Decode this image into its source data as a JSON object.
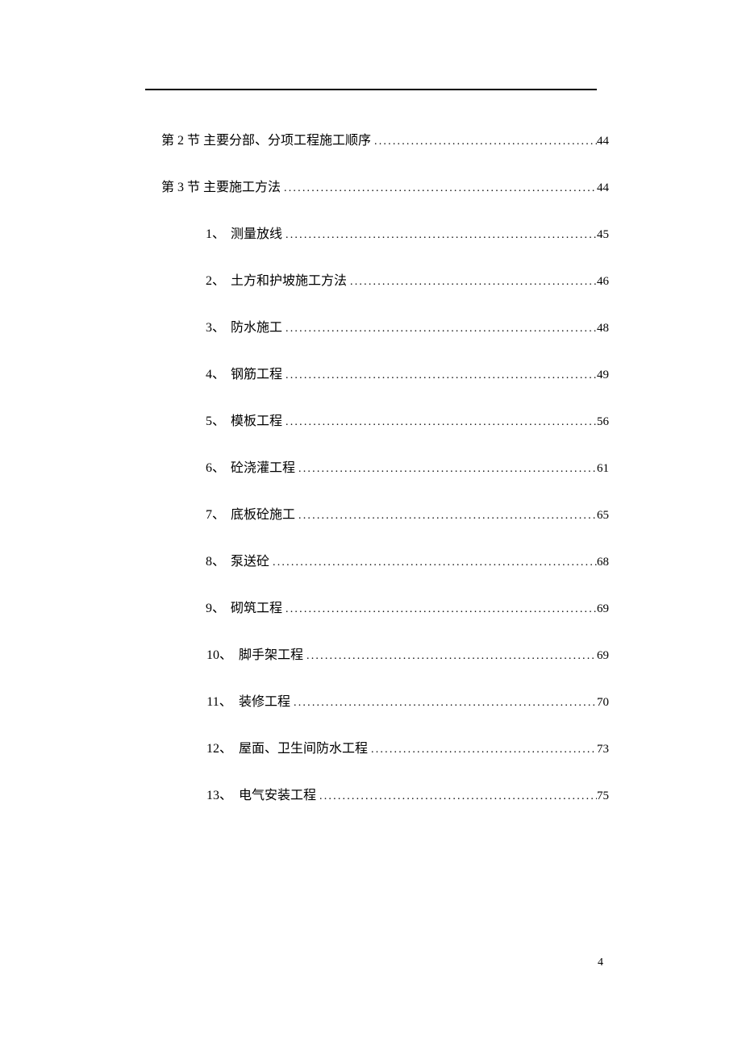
{
  "toc": [
    {
      "level": 0,
      "marker": "",
      "title": "第 2 节 主要分部、分项工程施工顺序",
      "page": "44"
    },
    {
      "level": 0,
      "marker": "",
      "title": "第 3 节 主要施工方法",
      "page": "44"
    },
    {
      "level": 1,
      "marker": "1、",
      "title": "测量放线",
      "page": "45"
    },
    {
      "level": 1,
      "marker": "2、",
      "title": "土方和护坡施工方法",
      "page": "46"
    },
    {
      "level": 1,
      "marker": "3、",
      "title": "防水施工",
      "page": "48"
    },
    {
      "level": 1,
      "marker": "4、",
      "title": "钢筋工程",
      "page": "49"
    },
    {
      "level": 1,
      "marker": "5、",
      "title": "模板工程",
      "page": "56"
    },
    {
      "level": 1,
      "marker": "6、",
      "title": "砼浇灌工程",
      "page": "61"
    },
    {
      "level": 1,
      "marker": "7、",
      "title": "底板砼施工",
      "page": "65"
    },
    {
      "level": 1,
      "marker": "8、",
      "title": "泵送砼",
      "page": "68"
    },
    {
      "level": 1,
      "marker": "9、",
      "title": "砌筑工程",
      "page": "69"
    },
    {
      "level": 1,
      "marker": "10、",
      "title": "脚手架工程",
      "page": "69"
    },
    {
      "level": 1,
      "marker": "11、",
      "title": "装修工程",
      "page": "70"
    },
    {
      "level": 1,
      "marker": "12、",
      "title": "屋面、卫生间防水工程",
      "page": "73"
    },
    {
      "level": 1,
      "marker": "13、",
      "title": "电气安装工程",
      "page": "75"
    }
  ],
  "page_number": "4"
}
